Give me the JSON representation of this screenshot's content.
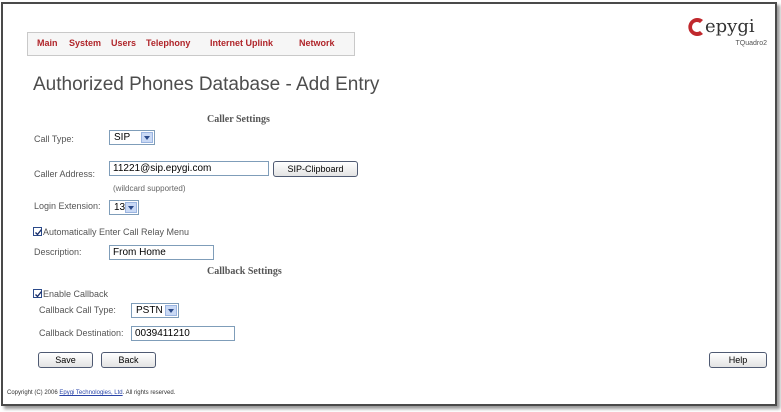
{
  "nav": {
    "items": [
      {
        "label": "Main"
      },
      {
        "label": "System"
      },
      {
        "label": "Users"
      },
      {
        "label": "Telephony"
      },
      {
        "label": "Internet Uplink"
      },
      {
        "label": "Network"
      }
    ]
  },
  "logo": {
    "brand": "epygi",
    "model": "TQuadro2"
  },
  "title": "Authorized Phones Database - Add Entry",
  "caller_settings": {
    "heading": "Caller Settings",
    "call_type_label": "Call Type:",
    "call_type_value": "SIP",
    "caller_address_label": "Caller Address:",
    "caller_address_value": "11221@sip.epygi.com",
    "sip_clipboard_label": "SIP-Clipboard",
    "wildcard_hint": "(wildcard supported)",
    "login_extension_label": "Login Extension:",
    "login_extension_value": "13",
    "auto_enter_label": "Automatically Enter Call Relay Menu",
    "auto_enter_checked": true,
    "description_label": "Description:",
    "description_value": "From Home"
  },
  "callback_settings": {
    "heading": "Callback Settings",
    "enable_label": "Enable Callback",
    "enable_checked": true,
    "call_type_label": "Callback Call Type:",
    "call_type_value": "PSTN",
    "destination_label": "Callback Destination:",
    "destination_value": "0039411210"
  },
  "buttons": {
    "save": "Save",
    "back": "Back",
    "help": "Help"
  },
  "footer": {
    "prefix": "Copyright (C) 2006 ",
    "company": "Epygi Technologies, Ltd",
    "suffix": ". All rights reserved."
  },
  "colors": {
    "nav_text": "#b0252a",
    "logo_red": "#c0282d"
  }
}
